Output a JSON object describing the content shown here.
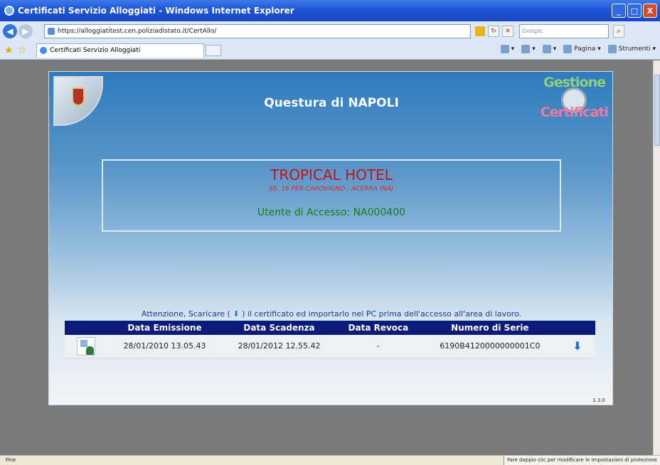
{
  "window": {
    "title": "Certificati Servizio Alloggiati - Windows Internet Explorer",
    "buttons": [
      "_",
      "□",
      "X"
    ]
  },
  "address": {
    "url": "https://alloggiatitest.cen.poliziadistato.it/CertAllo/",
    "search_placeholder": "Google"
  },
  "tabs": [
    {
      "label": "Certificati Servizio Alloggiati"
    }
  ],
  "commands": {
    "page": "Pagina",
    "tools": "Strumenti"
  },
  "page": {
    "title": "Questura di NAPOLI",
    "logo_right_top": "Gestione",
    "logo_right_bottom": "Certificati",
    "hotel_name": "TROPICAL HOTEL",
    "hotel_address": "SS. 16 PER CAROVIGNO - ACERRA (NA)",
    "user_label": "Utente di Accesso: NA000400",
    "attention_prefix": "Attenzione, Scaricare (",
    "attention_suffix": ") il certificato ed importarlo nel PC prima dell'accesso all'area di lavoro.",
    "version": "1.3.0"
  },
  "table": {
    "headers": [
      "Data Emissione",
      "Data Scadenza",
      "Data Revoca",
      "Numero di Serie"
    ],
    "rows": [
      {
        "emissione": "28/01/2010 13.05.43",
        "scadenza": "28/01/2012 12.55.42",
        "revoca": "-",
        "serie": "6190B4120000000001C0"
      }
    ]
  },
  "status": {
    "left": "Fine",
    "right": "Fare doppio clic per modificare le impostazioni di protezione"
  }
}
